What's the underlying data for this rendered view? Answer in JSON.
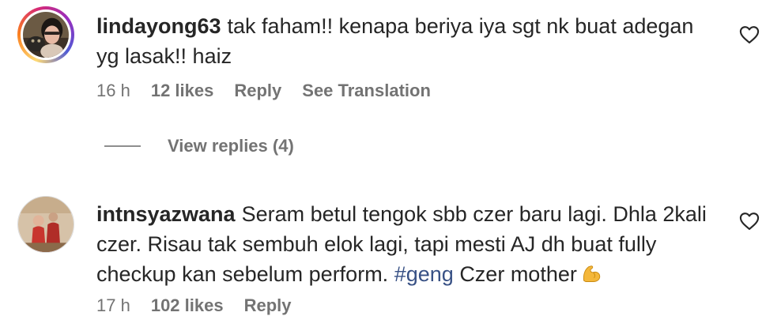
{
  "comments": [
    {
      "username": "lindayong63",
      "text": "tak faham!! kenapa beriya iya sgt nk buat adegan yg lasak!! haiz",
      "time": "16 h",
      "likes": "12 likes",
      "reply": "Reply",
      "translation": "See Translation",
      "view_replies": "View replies (4)"
    },
    {
      "username": "intnsyazwana",
      "text_before": "Seram betul tengok sbb czer baru lagi. Dhla 2kali czer. Risau tak sembuh elok lagi, tapi mesti AJ dh buat fully checkup kan sebelum perform.",
      "hashtag": "#geng",
      "text_after": "Czer mother",
      "emoji": "flexed-biceps-emoji",
      "time": "17 h",
      "likes": "102 likes",
      "reply": "Reply"
    }
  ],
  "icons": {
    "like": "heart-outline-icon"
  },
  "colors": {
    "hashtag": "#385185",
    "meta": "#737373",
    "text": "#262626"
  }
}
